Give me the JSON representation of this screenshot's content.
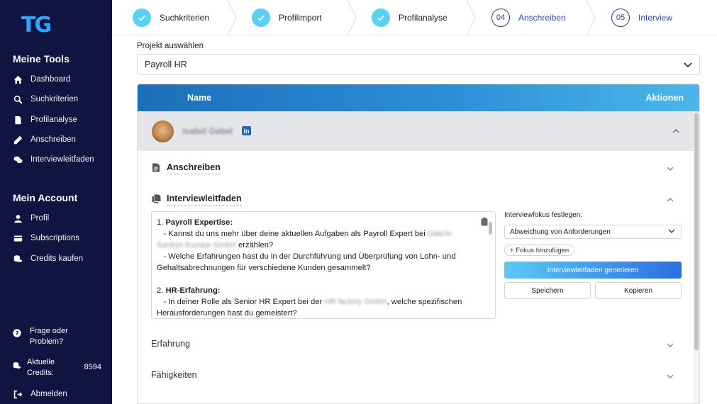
{
  "app": {
    "logo_text": "TG"
  },
  "sidebar": {
    "tools_heading": "Meine Tools",
    "tools": [
      {
        "label": "Dashboard",
        "icon": "home-icon"
      },
      {
        "label": "Suchkriterien",
        "icon": "search-icon"
      },
      {
        "label": "Profilanalyse",
        "icon": "document-icon"
      },
      {
        "label": "Anschreiben",
        "icon": "pencil-icon"
      },
      {
        "label": "Interviewleitfaden",
        "icon": "chat-icon"
      }
    ],
    "account_heading": "Mein Account",
    "account": [
      {
        "label": "Profil",
        "icon": "user-icon"
      },
      {
        "label": "Subscriptions",
        "icon": "card-icon"
      },
      {
        "label": "Credits kaufen",
        "icon": "coins-icon"
      }
    ],
    "help_label": "Frage oder Problem?",
    "credits_label": "Aktuelle Credits:",
    "credits_value": "8594",
    "logout_label": "Abmelden"
  },
  "stepper": {
    "steps": [
      {
        "label": "Suchkriterien",
        "state": "done"
      },
      {
        "label": "Profilimport",
        "state": "done"
      },
      {
        "label": "Profilanalyse",
        "state": "done"
      },
      {
        "label": "Anschreiben",
        "state": "todo",
        "number": "04"
      },
      {
        "label": "Interview",
        "state": "todo",
        "number": "05"
      }
    ]
  },
  "project": {
    "label": "Projekt auswählen",
    "selected": "Payroll HR"
  },
  "table": {
    "col_name": "Name",
    "col_actions": "Aktionen",
    "person": {
      "name": "Isabel Gebel",
      "linkedin": "in"
    },
    "sections": {
      "anschreiben": "Anschreiben",
      "interview": "Interviewleitfaden",
      "experience": "Erfahrung",
      "skills": "Fähigkeiten"
    },
    "guide": {
      "q1_num": "1. ",
      "q1_title": "Payroll Expertise:",
      "q1_a_pre": "   - Kannst du uns mehr über deine aktuellen Aufgaben als Payroll Expert bei ",
      "q1_a_company": "Daiichi Sankyo Europe GmbH",
      "q1_a_post": " erzählen?",
      "q1_b": "   - Welche Erfahrungen hast du in der Durchführung und Überprüfung von Lohn- und Gehaltsabrechnungen für verschiedene Kunden gesammelt?",
      "q2_num": "2. ",
      "q2_title": "HR-Erfahrung:",
      "q2_a_pre": "   - In deiner Rolle als Senior HR Expert bei der ",
      "q2_a_company": "HR factory GmbH",
      "q2_a_post": ", welche spezifischen Herausforderungen hast du gemeistert?"
    },
    "focus": {
      "label": "Interviewfokus festlegen:",
      "selected": "Abweichung von Anforderungen",
      "add": "+ Fokus hinzufügen",
      "generate": "Interviewleitfaden generieren",
      "save": "Speichern",
      "copy": "Kopieren"
    }
  },
  "colors": {
    "sidebar_bg": "#101440",
    "accent": "#2a6fe0",
    "step_done": "#5ad0f5"
  }
}
